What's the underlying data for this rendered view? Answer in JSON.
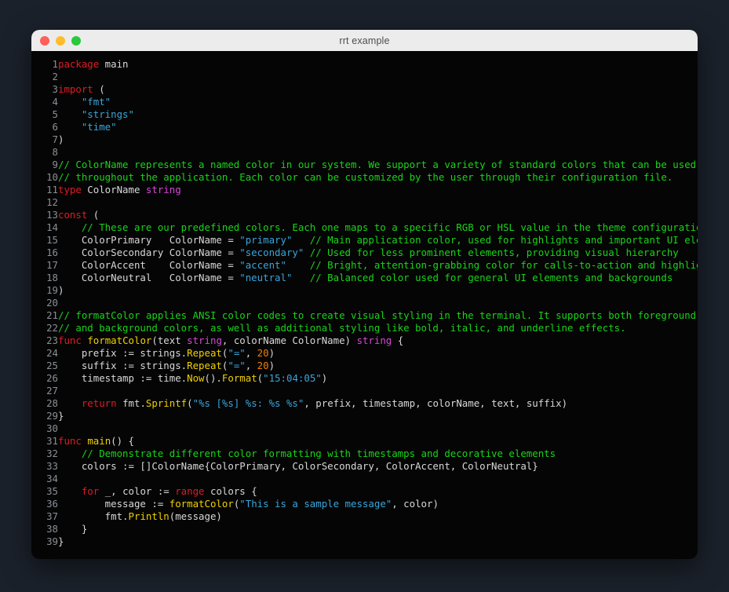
{
  "window": {
    "title": "rrt example",
    "traffic_lights": [
      {
        "name": "close-button",
        "color": "#ff6058"
      },
      {
        "name": "minimize-button",
        "color": "#ffbd2e"
      },
      {
        "name": "maximize-button",
        "color": "#28c93f"
      }
    ]
  },
  "theme": {
    "page_background": "#1b212b",
    "titlebar_background": "#ececec",
    "titlebar_text": "#4d4d4d",
    "code_background": "#050505",
    "line_number": "#8a8f96",
    "plain_text": "#d8d8d8",
    "keyword": "#e01b24",
    "comment": "#19d419",
    "string": "#3aa5d9",
    "type": "#d648d6",
    "function": "#f0d000",
    "number": "#f08000"
  },
  "editor": {
    "language": "go",
    "first_line": 1,
    "last_line": 39,
    "lines": [
      {
        "n": "1",
        "tokens": [
          {
            "t": "package",
            "c": "kw"
          },
          {
            "t": " main",
            "c": "pl"
          }
        ]
      },
      {
        "n": "2",
        "tokens": []
      },
      {
        "n": "3",
        "tokens": [
          {
            "t": "import",
            "c": "kw"
          },
          {
            "t": " (",
            "c": "pl"
          }
        ]
      },
      {
        "n": "4",
        "tokens": [
          {
            "t": "    ",
            "c": "pl"
          },
          {
            "t": "\"fmt\"",
            "c": "str"
          }
        ]
      },
      {
        "n": "5",
        "tokens": [
          {
            "t": "    ",
            "c": "pl"
          },
          {
            "t": "\"strings\"",
            "c": "str"
          }
        ]
      },
      {
        "n": "6",
        "tokens": [
          {
            "t": "    ",
            "c": "pl"
          },
          {
            "t": "\"time\"",
            "c": "str"
          }
        ]
      },
      {
        "n": "7",
        "tokens": [
          {
            "t": ")",
            "c": "pl"
          }
        ]
      },
      {
        "n": "8",
        "tokens": []
      },
      {
        "n": "9",
        "tokens": [
          {
            "t": "// ColorName represents a named color in our system. We support a variety of standard colors that can be used",
            "c": "cm"
          }
        ]
      },
      {
        "n": "10",
        "tokens": [
          {
            "t": "// throughout the application. Each color can be customized by the user through their configuration file.",
            "c": "cm"
          }
        ]
      },
      {
        "n": "11",
        "tokens": [
          {
            "t": "type",
            "c": "kw"
          },
          {
            "t": " ColorName ",
            "c": "pl"
          },
          {
            "t": "string",
            "c": "typ"
          }
        ]
      },
      {
        "n": "12",
        "tokens": []
      },
      {
        "n": "13",
        "tokens": [
          {
            "t": "const",
            "c": "kw"
          },
          {
            "t": " (",
            "c": "pl"
          }
        ]
      },
      {
        "n": "14",
        "tokens": [
          {
            "t": "    ",
            "c": "pl"
          },
          {
            "t": "// These are our predefined colors. Each one maps to a specific RGB or HSL value in the theme configuration.",
            "c": "cm"
          }
        ]
      },
      {
        "n": "15",
        "tokens": [
          {
            "t": "    ColorPrimary   ColorName = ",
            "c": "pl"
          },
          {
            "t": "\"primary\"",
            "c": "str"
          },
          {
            "t": "   ",
            "c": "pl"
          },
          {
            "t": "// Main application color, used for highlights and important UI elements",
            "c": "cm"
          }
        ]
      },
      {
        "n": "16",
        "tokens": [
          {
            "t": "    ColorSecondary ColorName = ",
            "c": "pl"
          },
          {
            "t": "\"secondary\"",
            "c": "str"
          },
          {
            "t": " ",
            "c": "pl"
          },
          {
            "t": "// Used for less prominent elements, providing visual hierarchy",
            "c": "cm"
          }
        ]
      },
      {
        "n": "17",
        "tokens": [
          {
            "t": "    ColorAccent    ColorName = ",
            "c": "pl"
          },
          {
            "t": "\"accent\"",
            "c": "str"
          },
          {
            "t": "    ",
            "c": "pl"
          },
          {
            "t": "// Bright, attention-grabbing color for calls-to-action and highlights",
            "c": "cm"
          }
        ]
      },
      {
        "n": "18",
        "tokens": [
          {
            "t": "    ColorNeutral   ColorName = ",
            "c": "pl"
          },
          {
            "t": "\"neutral\"",
            "c": "str"
          },
          {
            "t": "   ",
            "c": "pl"
          },
          {
            "t": "// Balanced color used for general UI elements and backgrounds",
            "c": "cm"
          }
        ]
      },
      {
        "n": "19",
        "tokens": [
          {
            "t": ")",
            "c": "pl"
          }
        ]
      },
      {
        "n": "20",
        "tokens": []
      },
      {
        "n": "21",
        "tokens": [
          {
            "t": "// formatColor applies ANSI color codes to create visual styling in the terminal. It supports both foreground",
            "c": "cm"
          }
        ]
      },
      {
        "n": "22",
        "tokens": [
          {
            "t": "// and background colors, as well as additional styling like bold, italic, and underline effects.",
            "c": "cm"
          }
        ]
      },
      {
        "n": "23",
        "tokens": [
          {
            "t": "func",
            "c": "kw"
          },
          {
            "t": " ",
            "c": "pl"
          },
          {
            "t": "formatColor",
            "c": "fn"
          },
          {
            "t": "(text ",
            "c": "pl"
          },
          {
            "t": "string",
            "c": "typ"
          },
          {
            "t": ", colorName ColorName) ",
            "c": "pl"
          },
          {
            "t": "string",
            "c": "typ"
          },
          {
            "t": " {",
            "c": "pl"
          }
        ]
      },
      {
        "n": "24",
        "tokens": [
          {
            "t": "    prefix := strings.",
            "c": "pl"
          },
          {
            "t": "Repeat",
            "c": "fn"
          },
          {
            "t": "(",
            "c": "pl"
          },
          {
            "t": "\"=\"",
            "c": "str"
          },
          {
            "t": ", ",
            "c": "pl"
          },
          {
            "t": "20",
            "c": "num"
          },
          {
            "t": ")",
            "c": "pl"
          }
        ]
      },
      {
        "n": "25",
        "tokens": [
          {
            "t": "    suffix := strings.",
            "c": "pl"
          },
          {
            "t": "Repeat",
            "c": "fn"
          },
          {
            "t": "(",
            "c": "pl"
          },
          {
            "t": "\"=\"",
            "c": "str"
          },
          {
            "t": ", ",
            "c": "pl"
          },
          {
            "t": "20",
            "c": "num"
          },
          {
            "t": ")",
            "c": "pl"
          }
        ]
      },
      {
        "n": "26",
        "tokens": [
          {
            "t": "    timestamp := time.",
            "c": "pl"
          },
          {
            "t": "Now",
            "c": "fn"
          },
          {
            "t": "().",
            "c": "pl"
          },
          {
            "t": "Format",
            "c": "fn"
          },
          {
            "t": "(",
            "c": "pl"
          },
          {
            "t": "\"15:04:05\"",
            "c": "str"
          },
          {
            "t": ")",
            "c": "pl"
          }
        ]
      },
      {
        "n": "27",
        "tokens": []
      },
      {
        "n": "28",
        "tokens": [
          {
            "t": "    ",
            "c": "pl"
          },
          {
            "t": "return",
            "c": "kw"
          },
          {
            "t": " fmt.",
            "c": "pl"
          },
          {
            "t": "Sprintf",
            "c": "fn"
          },
          {
            "t": "(",
            "c": "pl"
          },
          {
            "t": "\"%s [%s] %s: %s %s\"",
            "c": "str"
          },
          {
            "t": ", prefix, timestamp, colorName, text, suffix)",
            "c": "pl"
          }
        ]
      },
      {
        "n": "29",
        "tokens": [
          {
            "t": "}",
            "c": "pl"
          }
        ]
      },
      {
        "n": "30",
        "tokens": []
      },
      {
        "n": "31",
        "tokens": [
          {
            "t": "func",
            "c": "kw"
          },
          {
            "t": " ",
            "c": "pl"
          },
          {
            "t": "main",
            "c": "fn"
          },
          {
            "t": "() {",
            "c": "pl"
          }
        ]
      },
      {
        "n": "32",
        "tokens": [
          {
            "t": "    ",
            "c": "pl"
          },
          {
            "t": "// Demonstrate different color formatting with timestamps and decorative elements",
            "c": "cm"
          }
        ]
      },
      {
        "n": "33",
        "tokens": [
          {
            "t": "    colors := []ColorName{ColorPrimary, ColorSecondary, ColorAccent, ColorNeutral}",
            "c": "pl"
          }
        ]
      },
      {
        "n": "34",
        "tokens": []
      },
      {
        "n": "35",
        "tokens": [
          {
            "t": "    ",
            "c": "pl"
          },
          {
            "t": "for",
            "c": "kw"
          },
          {
            "t": " _, color := ",
            "c": "pl"
          },
          {
            "t": "range",
            "c": "kw"
          },
          {
            "t": " colors {",
            "c": "pl"
          }
        ]
      },
      {
        "n": "36",
        "tokens": [
          {
            "t": "        message := ",
            "c": "pl"
          },
          {
            "t": "formatColor",
            "c": "fn"
          },
          {
            "t": "(",
            "c": "pl"
          },
          {
            "t": "\"This is a sample message\"",
            "c": "str"
          },
          {
            "t": ", color)",
            "c": "pl"
          }
        ]
      },
      {
        "n": "37",
        "tokens": [
          {
            "t": "        fmt.",
            "c": "pl"
          },
          {
            "t": "Println",
            "c": "fn"
          },
          {
            "t": "(message)",
            "c": "pl"
          }
        ]
      },
      {
        "n": "38",
        "tokens": [
          {
            "t": "    }",
            "c": "pl"
          }
        ]
      },
      {
        "n": "39",
        "tokens": [
          {
            "t": "}",
            "c": "pl"
          }
        ]
      }
    ]
  }
}
